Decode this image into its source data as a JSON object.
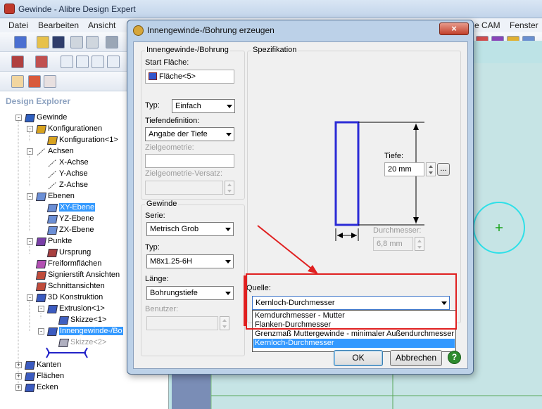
{
  "app": {
    "title": "Gewinde - Alibre Design Expert"
  },
  "menu": {
    "items": [
      "Datei",
      "Bearbeiten",
      "Ansicht",
      "e CAM",
      "Fenster"
    ]
  },
  "explorer": {
    "title": "Design Explorer",
    "nodes": [
      {
        "label": "Gewinde"
      },
      {
        "label": "Konfigurationen"
      },
      {
        "label": "Konfiguration<1>"
      },
      {
        "label": "Achsen"
      },
      {
        "label": "X-Achse"
      },
      {
        "label": "Y-Achse"
      },
      {
        "label": "Z-Achse"
      },
      {
        "label": "Ebenen"
      },
      {
        "label": "XY-Ebene"
      },
      {
        "label": "YZ-Ebene"
      },
      {
        "label": "ZX-Ebene"
      },
      {
        "label": "Punkte"
      },
      {
        "label": "Ursprung"
      },
      {
        "label": "Freiformflächen"
      },
      {
        "label": "Signierstift Ansichten"
      },
      {
        "label": "Schnittansichten"
      },
      {
        "label": "3D Konstruktion"
      },
      {
        "label": "Extrusion<1>"
      },
      {
        "label": "Skizze<1>"
      },
      {
        "label": "Innengewinde-/Bo"
      },
      {
        "label": "Skizze<2>"
      },
      {
        "label": "Kanten"
      },
      {
        "label": "Flächen"
      },
      {
        "label": "Ecken"
      }
    ]
  },
  "dialog": {
    "title": "Innengewinde-/Bohrung erzeugen",
    "close_glyph": "x",
    "bohrung_group": "Innengewinde-/Bohrung",
    "start_label": "Start Fläche:",
    "start_value": "Fläche<5>",
    "typ_label": "Typ:",
    "typ_value": "Einfach",
    "tiefen_label": "Tiefendefinition:",
    "tiefen_value": "Angabe der Tiefe",
    "zielgeo_label": "Zielgeometrie:",
    "zielgeo_value": "",
    "zielversatz_label": "Zielgeometrie-Versatz:",
    "gewinde_group": "Gewinde",
    "serie_label": "Serie:",
    "serie_value": "Metrisch Grob",
    "typ2_label": "Typ:",
    "typ2_value": "M8x1.25-6H",
    "laenge_label": "Länge:",
    "laenge_value": "Bohrungstiefe",
    "benutzer_label": "Benutzer:",
    "spez_group": "Spezifikation",
    "tiefe_label": "Tiefe:",
    "tiefe_value": "20 mm",
    "ellipsis": "...",
    "durchmesser_label": "Durchmesser:",
    "durchmesser_value": "6,8 mm",
    "quelle_label": "Quelle:",
    "quelle_value": "Kernloch-Durchmesser",
    "quelle_options": [
      "Kerndurchmesser - Mutter",
      "Flanken-Durchmesser",
      "Grenzmaß Muttergewinde - minimaler Außendurchmesser",
      "Kernloch-Durchmesser"
    ],
    "ok_label": "OK",
    "cancel_label": "Abbrechen",
    "help_label": "?"
  },
  "colors": {
    "annotation": "#e02020",
    "selection": "#3399ff",
    "viewport": "#bde3e6"
  }
}
